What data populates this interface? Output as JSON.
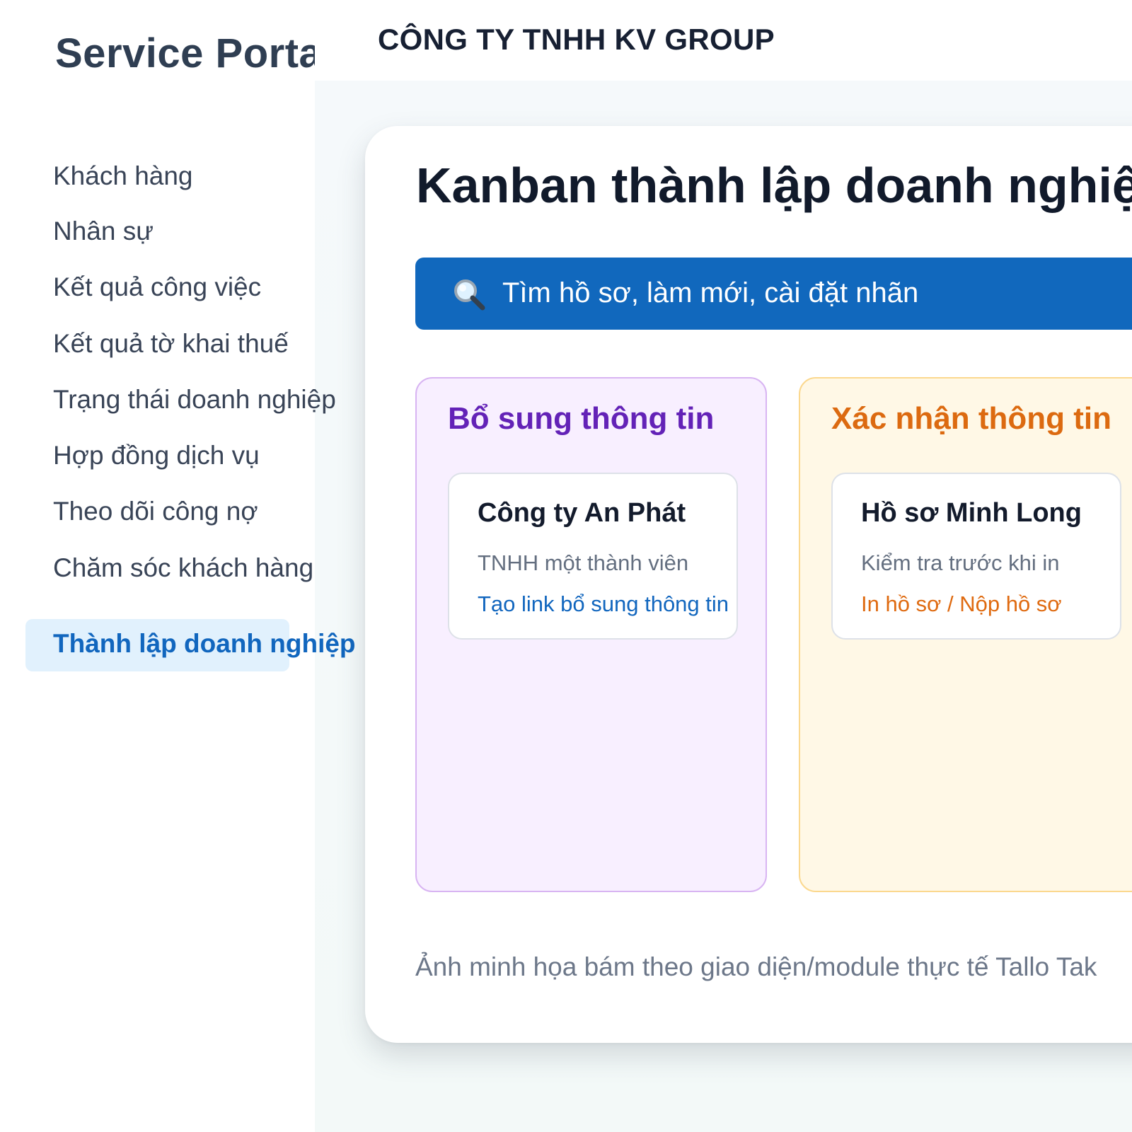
{
  "sidebar": {
    "brand": "Service Portal",
    "items": [
      {
        "label": "Khách hàng"
      },
      {
        "label": "Nhân sự"
      },
      {
        "label": "Kết quả công việc"
      },
      {
        "label": "Kết quả tờ khai thuế"
      },
      {
        "label": "Trạng thái doanh nghiệp"
      },
      {
        "label": "Hợp đồng dịch vụ"
      },
      {
        "label": "Theo dõi công nợ"
      },
      {
        "label": "Chăm sóc khách hàng"
      },
      {
        "label": "Thành lập doanh nghiệp",
        "active": true
      }
    ]
  },
  "header": {
    "company": "CÔNG TY TNHH KV GROUP"
  },
  "main": {
    "title": "Kanban thành lập doanh nghiệp",
    "search": {
      "icon": "magnifier-icon",
      "text": "Tìm hồ sơ, làm mới, cài đặt nhãn"
    },
    "columns": [
      {
        "title": "Bổ sung thông tin",
        "color": "#6322b7",
        "cards": [
          {
            "title": "Công ty An Phát",
            "subtitle": "TNHH một thành viên",
            "action": "Tạo link bổ sung thông tin"
          }
        ]
      },
      {
        "title": "Xác nhận thông tin",
        "color": "#dc6a10",
        "cards": [
          {
            "title": "Hồ sơ Minh Long",
            "subtitle": "Kiểm tra trước khi in",
            "action": "In hồ sơ / Nộp hồ sơ"
          }
        ]
      }
    ],
    "footnote": "Ảnh minh họa bám theo giao diện/module thực tế Tallo Tak"
  },
  "colors": {
    "accent_blue": "#1168bd",
    "active_nav_bg": "#e1f1fd",
    "purple_column_bg": "#f8efff",
    "orange_column_bg": "#fff8e6"
  }
}
